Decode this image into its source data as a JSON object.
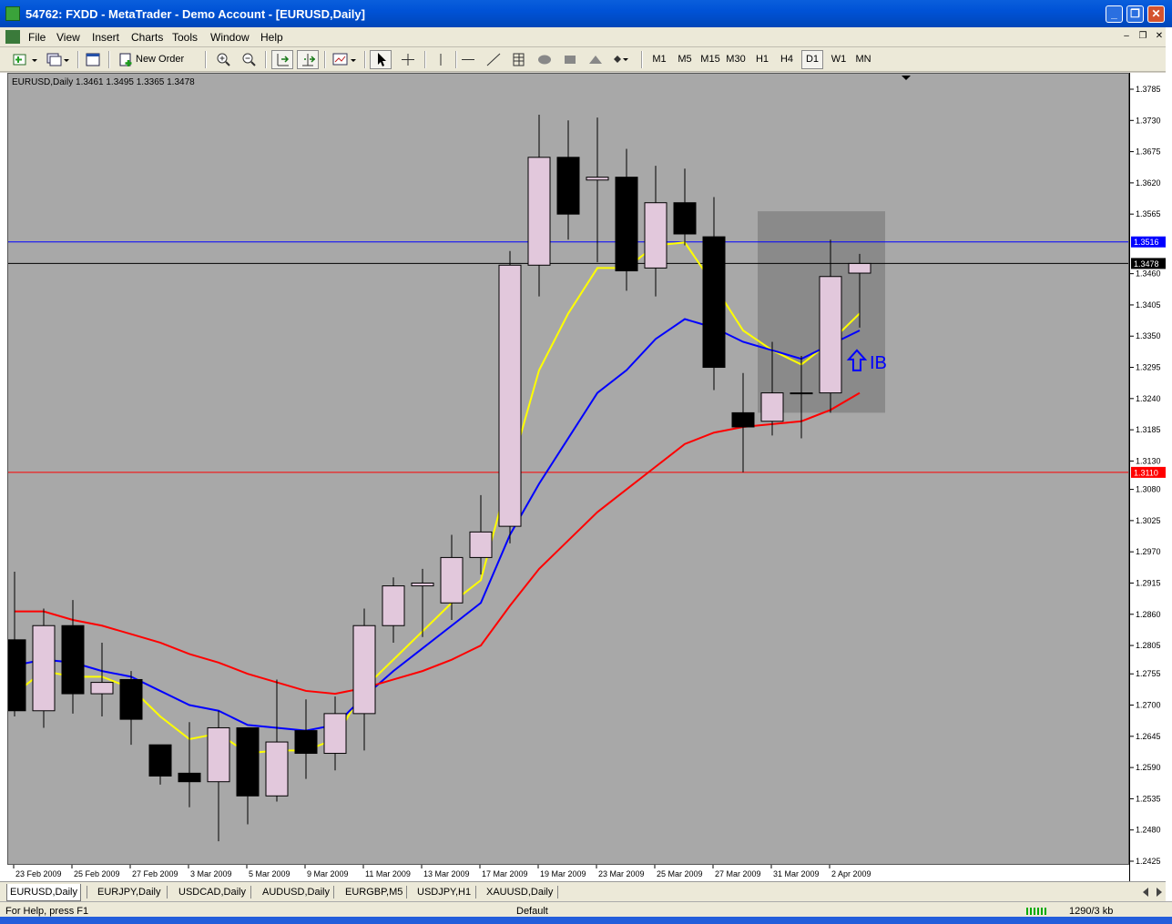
{
  "window": {
    "title": "54762: FXDD - MetaTrader - Demo Account - [EURUSD,Daily]",
    "minimize": "_",
    "restore": "❐",
    "close": "✕"
  },
  "menu": {
    "items": [
      "File",
      "View",
      "Insert",
      "Charts",
      "Tools",
      "Window",
      "Help"
    ],
    "mdi_min": "–",
    "mdi_restore": "❐",
    "mdi_close": "✕"
  },
  "toolbar": {
    "new_order": "New Order",
    "timeframes": [
      "M1",
      "M5",
      "M15",
      "M30",
      "H1",
      "H4",
      "D1",
      "W1",
      "MN"
    ],
    "active_timeframe": "D1"
  },
  "chart": {
    "header": "EURUSD,Daily  1.3461 1.3495 1.3365 1.3478",
    "annotation": "IB",
    "price_labels": [
      "1.3785",
      "1.3730",
      "1.3675",
      "1.3620",
      "1.3565",
      "1.3460",
      "1.3405",
      "1.3350",
      "1.3295",
      "1.3240",
      "1.3185",
      "1.3130",
      "1.3080",
      "1.3025",
      "1.2970",
      "1.2915",
      "1.2860",
      "1.2805",
      "1.2755",
      "1.2700",
      "1.2645",
      "1.2590",
      "1.2535",
      "1.2480",
      "1.2425"
    ],
    "line_blue_label": "1.3516",
    "line_black_label": "1.3478",
    "line_red_label": "1.3110",
    "time_labels": [
      "23 Feb 2009",
      "25 Feb 2009",
      "27 Feb 2009",
      "3 Mar 2009",
      "5 Mar 2009",
      "9 Mar 2009",
      "11 Mar 2009",
      "13 Mar 2009",
      "17 Mar 2009",
      "19 Mar 2009",
      "23 Mar 2009",
      "25 Mar 2009",
      "27 Mar 2009",
      "31 Mar 2009",
      "2 Apr 2009"
    ]
  },
  "tabs": [
    "EURUSD,Daily",
    "EURJPY,Daily",
    "USDCAD,Daily",
    "AUDUSD,Daily",
    "EURGBP,M5",
    "USDJPY,H1",
    "XAUUSD,Daily"
  ],
  "active_tab": "EURUSD,Daily",
  "status": {
    "help": "For Help, press F1",
    "profile": "Default",
    "traffic": "1290/3 kb"
  },
  "colors": {
    "bull_candle": "#e2c8dc",
    "bear_candle": "#000000",
    "ma_fast": "#ffff00",
    "ma_mid": "#0000ff",
    "ma_slow": "#ff0000",
    "resistance_line": "#0000ff",
    "support_line": "#ff0000",
    "chart_bg": "#a8a8a8"
  },
  "chart_data": {
    "type": "candlestick",
    "symbol": "EURUSD",
    "timeframe": "Daily",
    "ylim": [
      1.2425,
      1.3785
    ],
    "candles": [
      {
        "date": "20 Feb 2009",
        "open": 1.2815,
        "high": 1.2935,
        "low": 1.268,
        "close": 1.269
      },
      {
        "date": "23 Feb 2009",
        "open": 1.269,
        "high": 1.287,
        "low": 1.266,
        "close": 1.284
      },
      {
        "date": "24 Feb 2009",
        "open": 1.284,
        "high": 1.2885,
        "low": 1.2685,
        "close": 1.272
      },
      {
        "date": "25 Feb 2009",
        "open": 1.272,
        "high": 1.281,
        "low": 1.268,
        "close": 1.274
      },
      {
        "date": "26 Feb 2009",
        "open": 1.2745,
        "high": 1.276,
        "low": 1.263,
        "close": 1.2675
      },
      {
        "date": "27 Feb 2009",
        "open": 1.263,
        "high": 1.263,
        "low": 1.256,
        "close": 1.2575
      },
      {
        "date": "2 Mar 2009",
        "open": 1.258,
        "high": 1.267,
        "low": 1.252,
        "close": 1.2565
      },
      {
        "date": "3 Mar 2009",
        "open": 1.2565,
        "high": 1.269,
        "low": 1.246,
        "close": 1.266
      },
      {
        "date": "4 Mar 2009",
        "open": 1.266,
        "high": 1.266,
        "low": 1.249,
        "close": 1.254
      },
      {
        "date": "5 Mar 2009",
        "open": 1.254,
        "high": 1.2745,
        "low": 1.253,
        "close": 1.2635
      },
      {
        "date": "6 Mar 2009",
        "open": 1.2655,
        "high": 1.271,
        "low": 1.257,
        "close": 1.2615
      },
      {
        "date": "9 Mar 2009",
        "open": 1.2615,
        "high": 1.2715,
        "low": 1.2585,
        "close": 1.2685
      },
      {
        "date": "10 Mar 2009",
        "open": 1.2685,
        "high": 1.287,
        "low": 1.262,
        "close": 1.284
      },
      {
        "date": "11 Mar 2009",
        "open": 1.284,
        "high": 1.2925,
        "low": 1.281,
        "close": 1.291
      },
      {
        "date": "12 Mar 2009",
        "open": 1.291,
        "high": 1.294,
        "low": 1.282,
        "close": 1.2915
      },
      {
        "date": "13 Mar 2009",
        "open": 1.288,
        "high": 1.3,
        "low": 1.285,
        "close": 1.296
      },
      {
        "date": "16 Mar 2009",
        "open": 1.296,
        "high": 1.307,
        "low": 1.293,
        "close": 1.3005
      },
      {
        "date": "17 Mar 2009",
        "open": 1.3015,
        "high": 1.35,
        "low": 1.2985,
        "close": 1.3475
      },
      {
        "date": "18 Mar 2009",
        "open": 1.3475,
        "high": 1.374,
        "low": 1.342,
        "close": 1.3665
      },
      {
        "date": "19 Mar 2009",
        "open": 1.3665,
        "high": 1.373,
        "low": 1.352,
        "close": 1.3565
      },
      {
        "date": "20 Mar 2009",
        "open": 1.3625,
        "high": 1.3735,
        "low": 1.348,
        "close": 1.363
      },
      {
        "date": "23 Mar 2009",
        "open": 1.363,
        "high": 1.368,
        "low": 1.343,
        "close": 1.3465
      },
      {
        "date": "24 Mar 2009",
        "open": 1.347,
        "high": 1.365,
        "low": 1.342,
        "close": 1.3585
      },
      {
        "date": "25 Mar 2009",
        "open": 1.3585,
        "high": 1.3645,
        "low": 1.351,
        "close": 1.353
      },
      {
        "date": "26 Mar 2009",
        "open": 1.3525,
        "high": 1.3595,
        "low": 1.3255,
        "close": 1.3295
      },
      {
        "date": "27 Mar 2009",
        "open": 1.3215,
        "high": 1.3285,
        "low": 1.311,
        "close": 1.319
      },
      {
        "date": "30 Mar 2009",
        "open": 1.32,
        "high": 1.334,
        "low": 1.3175,
        "close": 1.325
      },
      {
        "date": "31 Mar 2009",
        "open": 1.325,
        "high": 1.3315,
        "low": 1.317,
        "close": 1.325
      },
      {
        "date": "1 Apr 2009",
        "open": 1.325,
        "high": 1.352,
        "low": 1.3215,
        "close": 1.3455
      },
      {
        "date": "2 Apr 2009",
        "open": 1.3461,
        "high": 1.3495,
        "low": 1.3365,
        "close": 1.3478
      }
    ],
    "moving_averages": [
      {
        "color": "#ffff00",
        "values": [
          1.272,
          1.276,
          1.275,
          1.275,
          1.273,
          1.268,
          1.264,
          1.265,
          1.2615,
          1.262,
          1.262,
          1.264,
          1.273,
          1.278,
          1.283,
          1.288,
          1.292,
          1.311,
          1.329,
          1.339,
          1.347,
          1.347,
          1.351,
          1.3515,
          1.344,
          1.336,
          1.3325,
          1.33,
          1.334,
          1.339
        ]
      },
      {
        "color": "#0000ff",
        "values": [
          1.277,
          1.278,
          1.2775,
          1.276,
          1.275,
          1.2725,
          1.27,
          1.269,
          1.2665,
          1.266,
          1.2655,
          1.2665,
          1.2715,
          1.276,
          1.28,
          1.284,
          1.288,
          1.3,
          1.309,
          1.317,
          1.325,
          1.329,
          1.3345,
          1.338,
          1.3365,
          1.334,
          1.3325,
          1.331,
          1.3335,
          1.336
        ]
      },
      {
        "color": "#ff0000",
        "values": [
          1.2865,
          1.2865,
          1.285,
          1.284,
          1.2825,
          1.281,
          1.279,
          1.2775,
          1.2755,
          1.274,
          1.2725,
          1.272,
          1.273,
          1.2745,
          1.276,
          1.278,
          1.2805,
          1.2875,
          1.294,
          1.299,
          1.304,
          1.308,
          1.312,
          1.316,
          1.318,
          1.319,
          1.3195,
          1.32,
          1.322,
          1.325
        ]
      }
    ],
    "horizontal_lines": [
      {
        "price": 1.3516,
        "color": "#0000ff"
      },
      {
        "price": 1.3478,
        "color": "#000000"
      },
      {
        "price": 1.311,
        "color": "#ff0000"
      }
    ],
    "highlight_box": {
      "from_index": 26,
      "to_index": 30,
      "price_low": 1.3215,
      "price_high": 1.357
    }
  }
}
